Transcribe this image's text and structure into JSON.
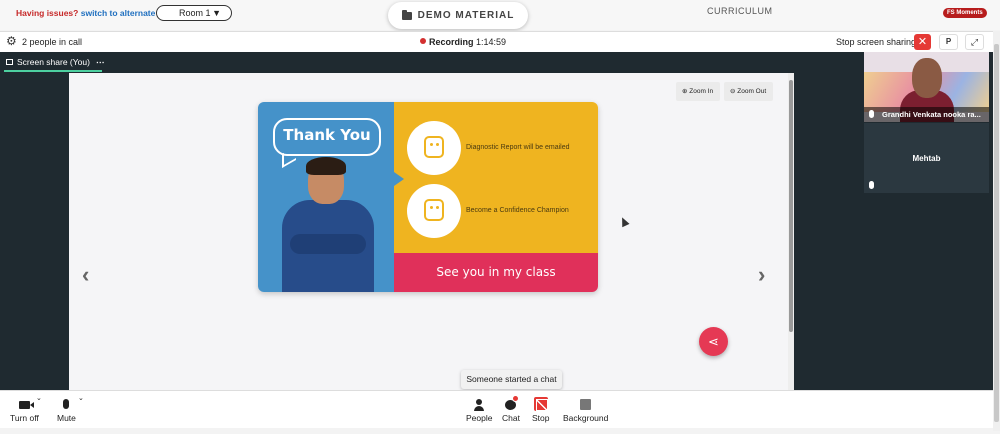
{
  "topbar": {
    "issues_text": "Having issues?",
    "switch_link": "switch to alternate room",
    "room_select": "Room 1",
    "demo_tab": "DEMO MATERIAL",
    "curriculum_tab": "CURRICULUM",
    "fs_badge": "FS Moments"
  },
  "callbar": {
    "people_count": "2 people in call",
    "recording_label": "Recording",
    "recording_time": "1:14:59",
    "stop_sharing": "Stop screen sharing",
    "p_label": "P"
  },
  "stage": {
    "tab_label": "Screen share (You)",
    "tab_more": "⋯",
    "zoom_in": "Zoom In",
    "zoom_out": "Zoom Out"
  },
  "slide": {
    "bubble": "Thank You",
    "item_1": "Diagnostic Report will be emailed",
    "item_2": "Become a Confidence Champion",
    "footer": "See you in my class"
  },
  "participants": [
    {
      "name": "Grandhi Venkata nooka ra..."
    },
    {
      "name": "Mehtab"
    }
  ],
  "toast": "Someone started a chat",
  "controls": {
    "turn_off": "Turn off",
    "mute": "Mute",
    "people": "People",
    "chat": "Chat",
    "stop": "Stop",
    "background": "Background"
  },
  "colors": {
    "accent_red": "#e53935",
    "slide_blue": "#4592c9",
    "slide_yellow": "#efb420",
    "slide_pink": "#e0305a",
    "stage_dark": "#1f2a30"
  }
}
